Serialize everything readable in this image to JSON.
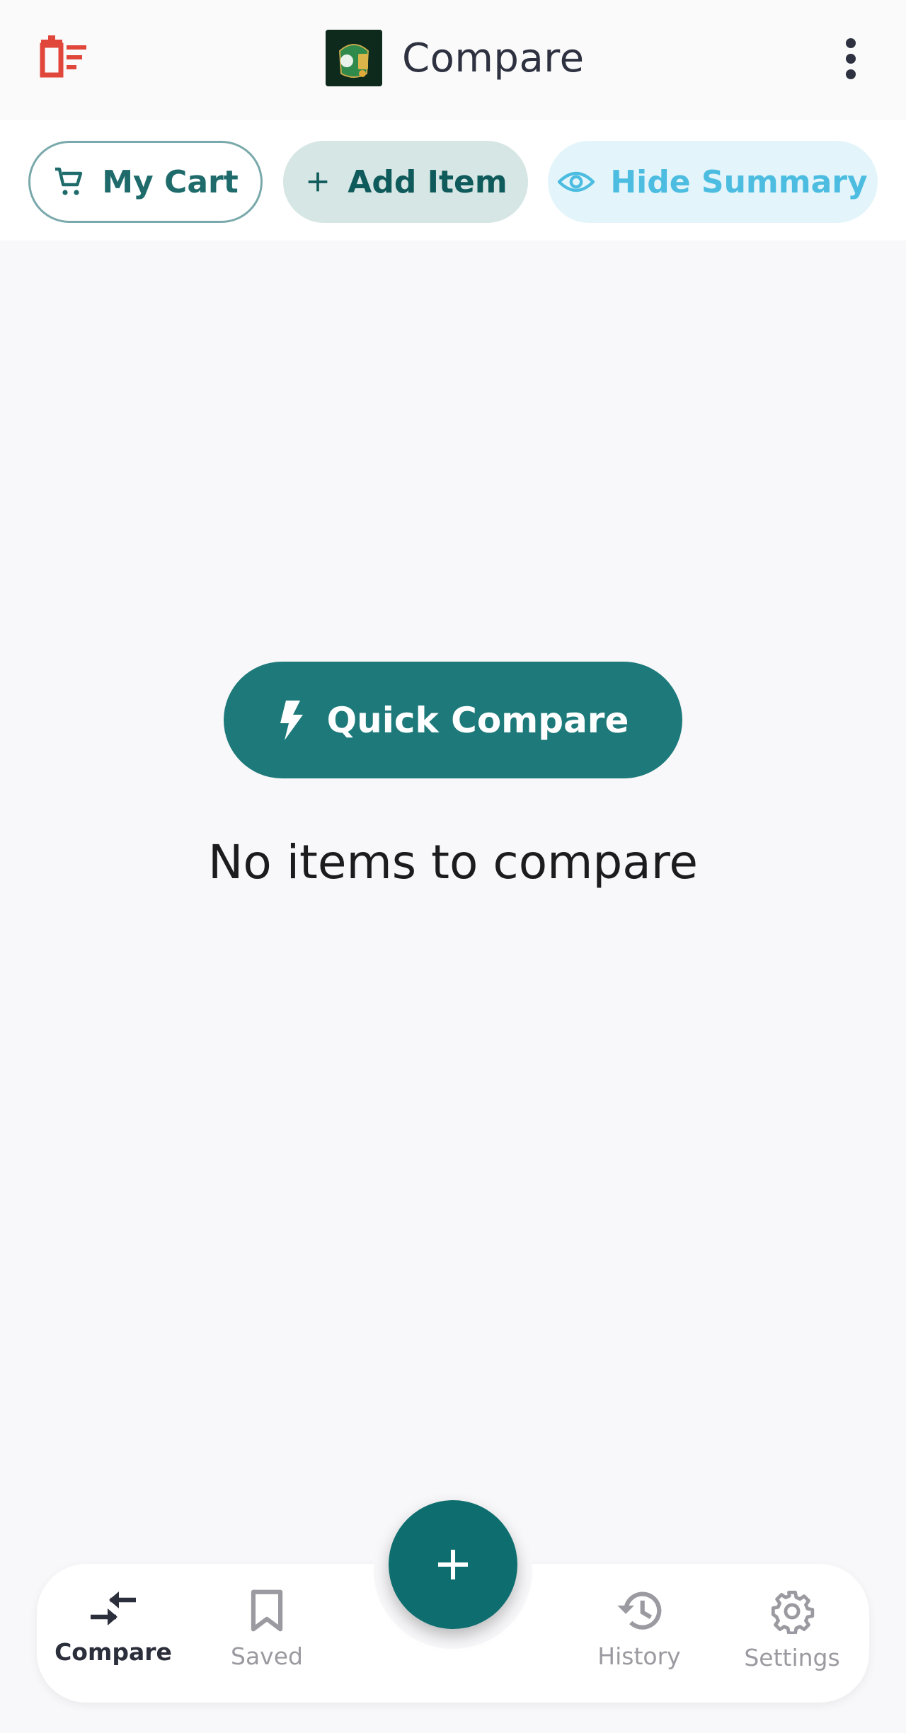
{
  "app_bar": {
    "title": "Compare",
    "clear_icon": "delete-list-icon",
    "menu_icon": "more-vert-icon"
  },
  "chips": {
    "cart_label": "My Cart",
    "add_label": "Add Item",
    "hide_label": "Hide Summary"
  },
  "main": {
    "quick_compare_label": "Quick Compare",
    "empty_message": "No items to compare"
  },
  "bottom_nav": {
    "items": [
      {
        "label": "Compare",
        "icon": "compare-arrows-icon",
        "active": true
      },
      {
        "label": "Saved",
        "icon": "bookmark-icon",
        "active": false
      },
      {
        "label": "History",
        "icon": "history-icon",
        "active": false
      },
      {
        "label": "Settings",
        "icon": "gear-icon",
        "active": false
      }
    ]
  },
  "colors": {
    "primary": "#1e7a7a",
    "fab": "#0e6e6f",
    "danger": "#e0463a",
    "accent_light": "#4cbde0"
  }
}
